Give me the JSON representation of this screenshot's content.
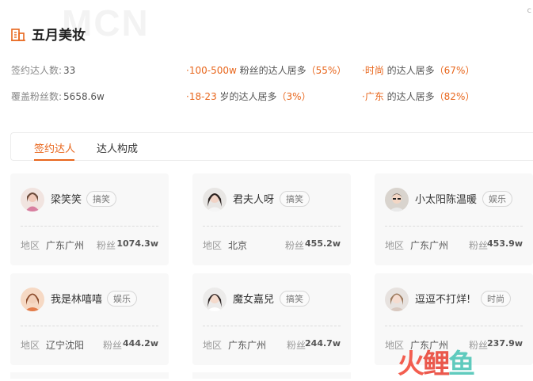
{
  "watermark_text": "MCN",
  "corner_mark": "c",
  "agency": {
    "name": "五月美妆",
    "icon": "building-icon"
  },
  "stats": {
    "signed_label": "签约达人数:",
    "signed_value": "33",
    "fans_label": "覆盖粉丝数:",
    "fans_value": "5658.6w"
  },
  "traits": [
    {
      "prefix": "·",
      "highlight": "100-500w",
      "text": " 粉丝的达人居多",
      "pct": "（55%）"
    },
    {
      "prefix": "·",
      "highlight": "时尚",
      "text": " 的达人居多",
      "pct": "（67%）"
    },
    {
      "prefix": "·",
      "highlight": "18-23",
      "text": " 岁的达人居多",
      "pct": "（3%）"
    },
    {
      "prefix": "·",
      "highlight": "广东",
      "text": " 的达人居多",
      "pct": "（82%）"
    }
  ],
  "tabs": [
    {
      "label": "签约达人",
      "active": true
    },
    {
      "label": "达人构成",
      "active": false
    }
  ],
  "card_labels": {
    "region": "地区",
    "fans": "粉丝"
  },
  "cards": [
    {
      "name": "梁笑笑",
      "tag": "搞笑",
      "region": "广东广州",
      "fans": "1074.3w"
    },
    {
      "name": "君夫人呀",
      "tag": "搞笑",
      "region": "北京",
      "fans": "455.2w"
    },
    {
      "name": "小太阳陈温暖",
      "tag": "娱乐",
      "region": "广东广州",
      "fans": "453.9w"
    },
    {
      "name": "我是林嘻嘻",
      "tag": "娱乐",
      "region": "辽宁沈阳",
      "fans": "444.2w"
    },
    {
      "name": "魔女嘉兒",
      "tag": "搞笑",
      "region": "广东广州",
      "fans": "244.7w"
    },
    {
      "name": "逗逗不打烊!",
      "tag": "时尚",
      "region": "广东广州",
      "fans": "237.9w"
    }
  ],
  "watermark_logo": {
    "part1": "火",
    "part2": "鲤",
    "part3": "鱼"
  },
  "colors": {
    "accent": "#e8661c",
    "card_bg": "#f8f8f8"
  }
}
